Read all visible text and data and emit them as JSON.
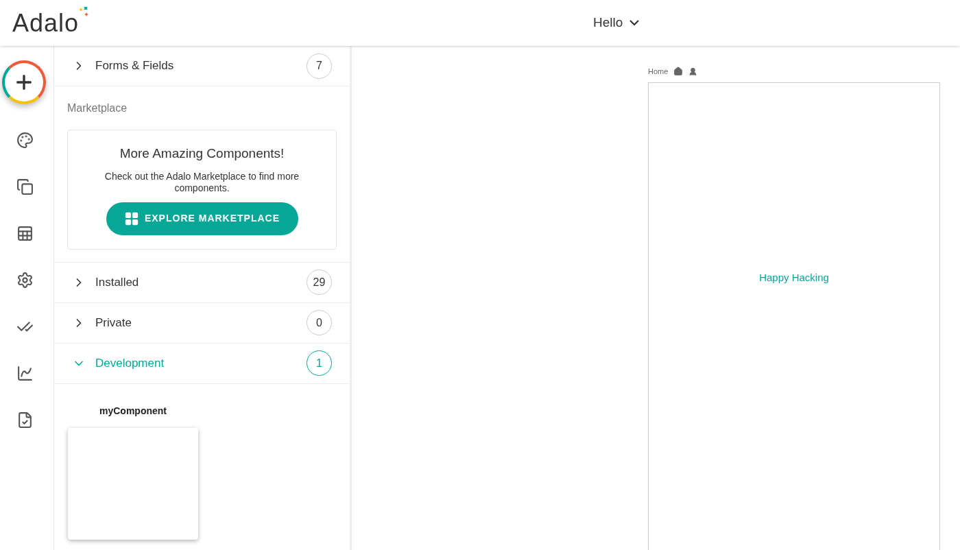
{
  "logo": "Adalo",
  "app_menu": {
    "label": "Hello"
  },
  "categories_top": [
    {
      "label": "Forms & Fields",
      "count": "7",
      "expanded": false
    }
  ],
  "marketplace": {
    "heading": "Marketplace",
    "title": "More Amazing Components!",
    "text": "Check out the Adalo Marketplace to find more components.",
    "button": "EXPLORE MARKETPLACE"
  },
  "categories": [
    {
      "label": "Installed",
      "count": "29",
      "expanded": false
    },
    {
      "label": "Private",
      "count": "0",
      "expanded": false
    },
    {
      "label": "Development",
      "count": "1",
      "expanded": true
    }
  ],
  "components": [
    {
      "name": "myComponent"
    }
  ],
  "screen": {
    "name": "Home",
    "body": "Happy Hacking"
  }
}
